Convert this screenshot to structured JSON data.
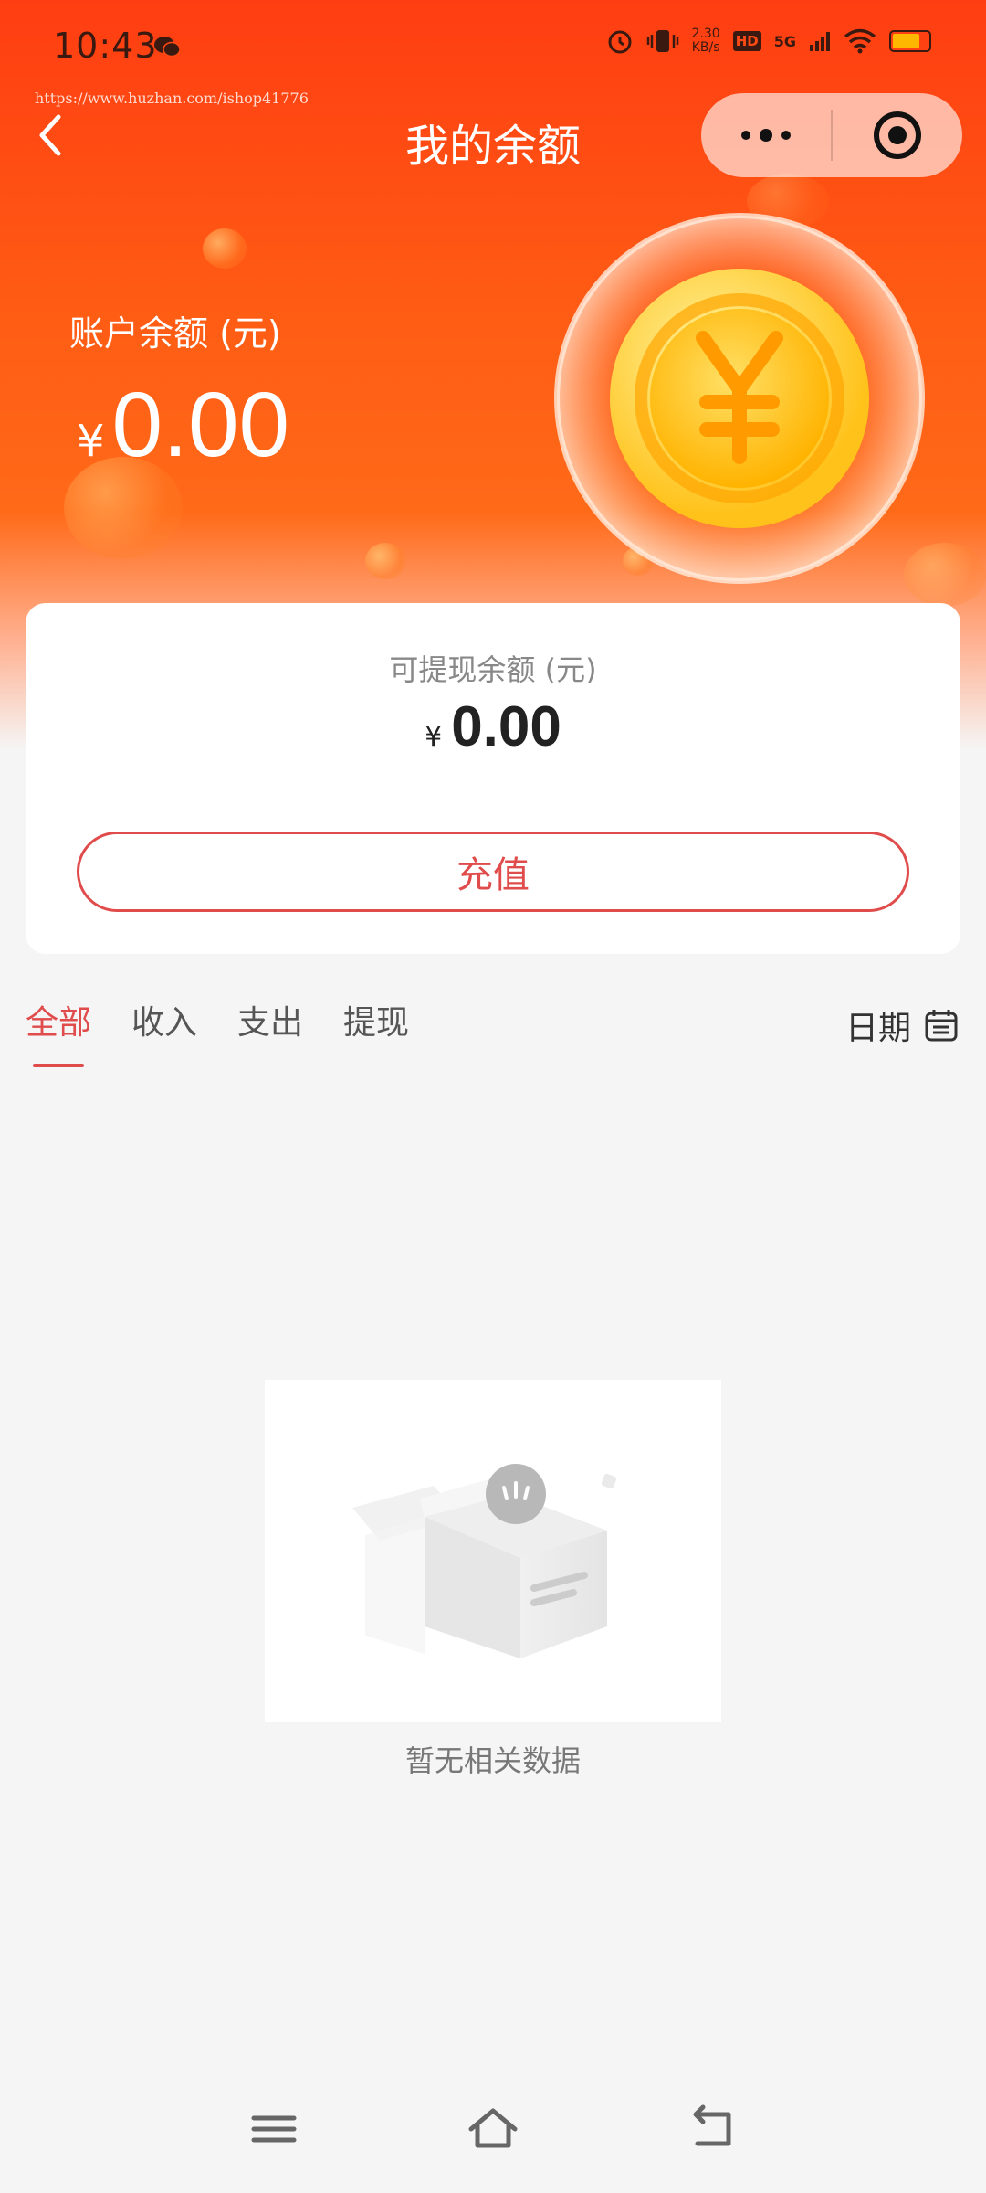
{
  "status_bar": {
    "time": "10:43",
    "speed_value": "2.30",
    "speed_unit": "KB/s",
    "hd": "HD",
    "network": "5G"
  },
  "watermark": "https://www.huzhan.com/ishop41776",
  "nav": {
    "title": "我的余额"
  },
  "balance": {
    "label": "账户余额 (元)",
    "currency": "¥",
    "value": "0.00"
  },
  "withdrawable": {
    "label": "可提现余额 (元)",
    "currency": "¥",
    "value": "0.00"
  },
  "recharge_label": "充值",
  "tabs": [
    {
      "label": "全部",
      "active": true
    },
    {
      "label": "收入",
      "active": false
    },
    {
      "label": "支出",
      "active": false
    },
    {
      "label": "提现",
      "active": false
    }
  ],
  "date_filter_label": "日期",
  "empty_text": "暂无相关数据",
  "colors": {
    "accent": "#e04b4b",
    "header_orange": "#ff5a14",
    "page_bg": "#f5f5f5"
  },
  "icons": {
    "back": "chevron-left-icon",
    "more": "more-dots-icon",
    "close": "target-close-icon",
    "calendar": "calendar-icon",
    "menu": "menu-icon",
    "home": "home-icon",
    "return": "back-arrow-icon"
  }
}
